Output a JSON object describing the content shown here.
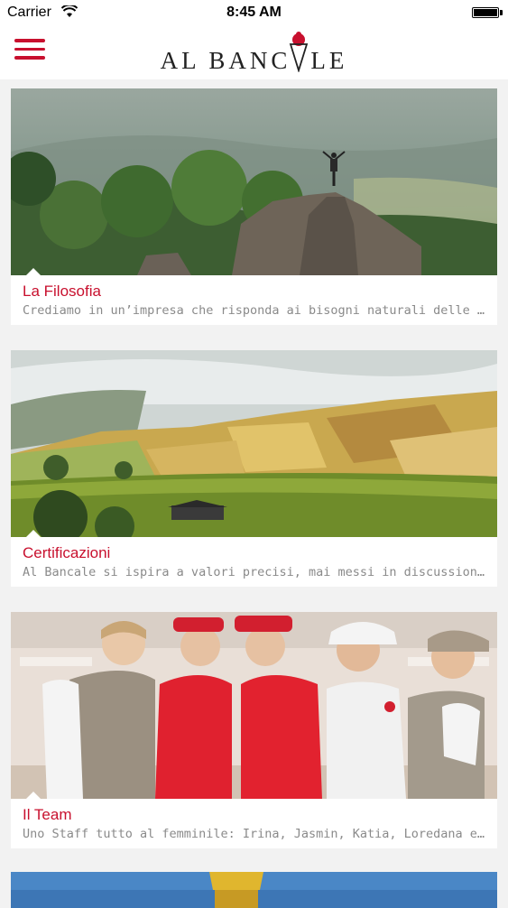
{
  "status_bar": {
    "carrier": "Carrier",
    "time": "8:45 AM",
    "battery_level": 1.0
  },
  "header": {
    "logo_text_left": "AL BANC",
    "logo_text_right": "LE",
    "menu_icon": "hamburger-menu-icon",
    "logo_icon": "ice-cream-cone-icon",
    "accent_color": "#c8102e"
  },
  "cards": [
    {
      "title": "La Filosofia",
      "description": "Crediamo in un’impresa che risponda ai bisogni naturali delle persone",
      "image": "hiker-on-rock-peak-landscape"
    },
    {
      "title": "Certificazioni",
      "description": "Al Bancale si ispira a valori precisi, mai messi in discussione, elevando",
      "image": "terraced-green-fields-landscape"
    },
    {
      "title": "Il Team",
      "description": "Uno Staff tutto al femminile: Irina, Jasmin, Katia, Loredana e Luisa",
      "image": "team-group-photo"
    }
  ]
}
